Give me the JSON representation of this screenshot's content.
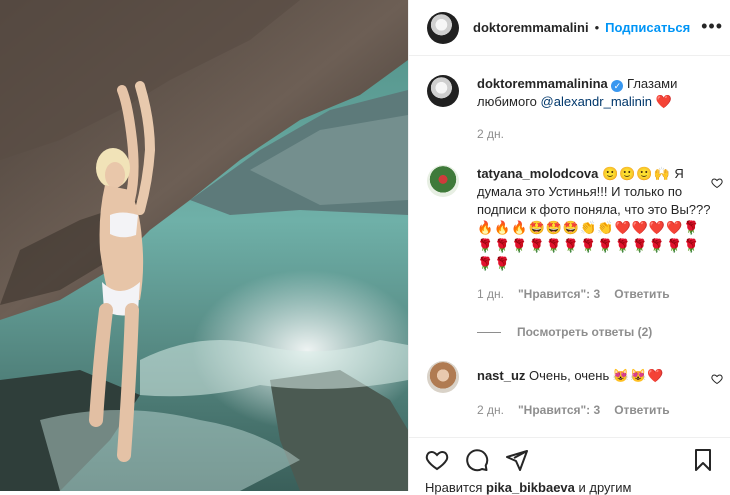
{
  "header": {
    "username": "doktoremmamalini",
    "separator": "•",
    "follow_label": "Подписаться",
    "more_icon": "ellipsis-icon"
  },
  "caption": {
    "username": "doktoremmamalinina",
    "text": "Глазами любимого",
    "mention": "@alexandr_malinin",
    "emoji": "❤️",
    "time": "2 дн."
  },
  "comments": [
    {
      "username": "tatyana_molodcova",
      "emojis": "🙂🙂🙂🙌",
      "text": "Я думала это Устинья!!! И только по подписи к фото поняла, что это Вы???",
      "emojis_line": "🔥🔥🔥🤩🤩🤩👏👏❤️❤️❤️❤️🌹🌹🌹🌹🌹🌹🌹🌹🌹🌹🌹🌹🌹🌹🌹🌹",
      "time": "1 дн.",
      "likes": "\"Нравится\": 3",
      "reply": "Ответить",
      "view_replies": "Посмотреть ответы (2)"
    },
    {
      "username": "nast_uz",
      "text": "Очень, очень",
      "emojis": "😻😻❤️",
      "time": "2 дн.",
      "likes": "\"Нравится\": 3",
      "reply": "Ответить"
    }
  ],
  "actions": {
    "like_icon": "heart-icon",
    "comment_icon": "comment-icon",
    "share_icon": "share-icon",
    "save_icon": "bookmark-icon",
    "likes_prefix": "Нравится",
    "likes_user": "pika_bikbaeva",
    "likes_suffix": "и другим"
  },
  "colors": {
    "accent": "#0095f6",
    "heart": "#ed4956",
    "muted": "#8e8e8e"
  }
}
